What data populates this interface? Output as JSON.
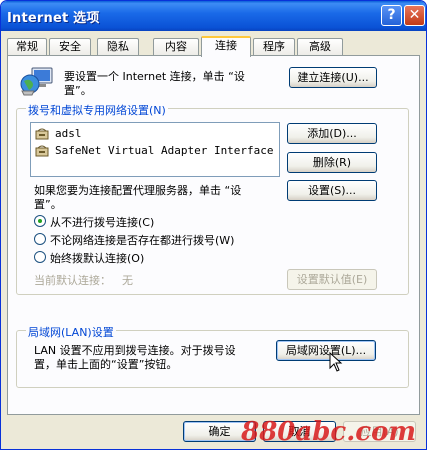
{
  "window": {
    "title": "Internet 选项"
  },
  "titlebar": {
    "help_glyph": "?",
    "close_glyph": "✕"
  },
  "tabs": [
    {
      "label": "常规"
    },
    {
      "label": "安全"
    },
    {
      "label": "隐私"
    },
    {
      "label": "内容"
    },
    {
      "label": "连接",
      "active": true
    },
    {
      "label": "程序"
    },
    {
      "label": "高级"
    }
  ],
  "setup": {
    "text_line1": "要设置一个 Internet 连接，单击 “设",
    "text_line2": "置”。",
    "button": "建立连接(U)..."
  },
  "dialup": {
    "group_label": "拨号和虚拟专用网络设置(N)",
    "items": [
      "adsl",
      "SafeNet Virtual Adapter Interface"
    ],
    "add_button": "添加(D)...",
    "remove_button": "删除(R)",
    "settings_button": "设置(S)...",
    "proxy_line1": "如果您要为连接配置代理服务器，单击 “设",
    "proxy_line2": "置”。",
    "radio_options": [
      {
        "label": "从不进行拨号连接(C)",
        "checked": true
      },
      {
        "label": "不论网络连接是否存在都进行拨号(W)",
        "checked": false
      },
      {
        "label": "始终拨默认连接(O)",
        "checked": false
      }
    ],
    "current_default_label": "当前默认连接：",
    "current_default_value": "无",
    "set_default_button": "设置默认值(E)"
  },
  "lan": {
    "group_label": "局域网(LAN)设置",
    "text_line1": "LAN 设置不应用到拨号连接。对于拨号设",
    "text_line2": "置，单击上面的“设置”按钮。",
    "button": "局域网设置(L)..."
  },
  "footer": {
    "ok": "确定",
    "cancel": "取消",
    "apply": "应用(A)"
  },
  "watermark": "880abc.com"
}
